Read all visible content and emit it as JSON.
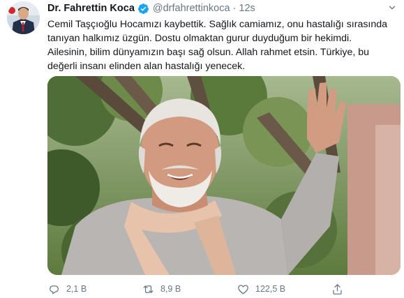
{
  "author": {
    "name": "Dr. Fahrettin Koca",
    "handle": "@drfahrettinkoca",
    "separator": "·",
    "time": "12s",
    "verified": true
  },
  "tweet": {
    "lines": [
      "Cemil Taşçıoğlu Hocamızı kaybettik. Sağlık camiamız, onu hastalığı sırasında",
      "tanıyan halkımız üzgün. Dostu olmaktan gurur duyduğum bir hekimdi.",
      "Ailesinin, bilim dünyamızın başı sağ olsun. Allah rahmet etsin. Türkiye, bu",
      "değerli insanı elinden alan hastalığı yenecek."
    ]
  },
  "actions": {
    "replies": "2,1 B",
    "retweets": "8,9 B",
    "likes": "122,5 B"
  },
  "icons": {
    "verified": "verified-badge-icon",
    "caret": "chevron-down-icon",
    "reply": "reply-icon",
    "retweet": "retweet-icon",
    "like": "heart-icon",
    "share": "share-icon"
  },
  "colors": {
    "accent": "#1da1f2",
    "muted": "#657786",
    "text": "#14171a"
  }
}
